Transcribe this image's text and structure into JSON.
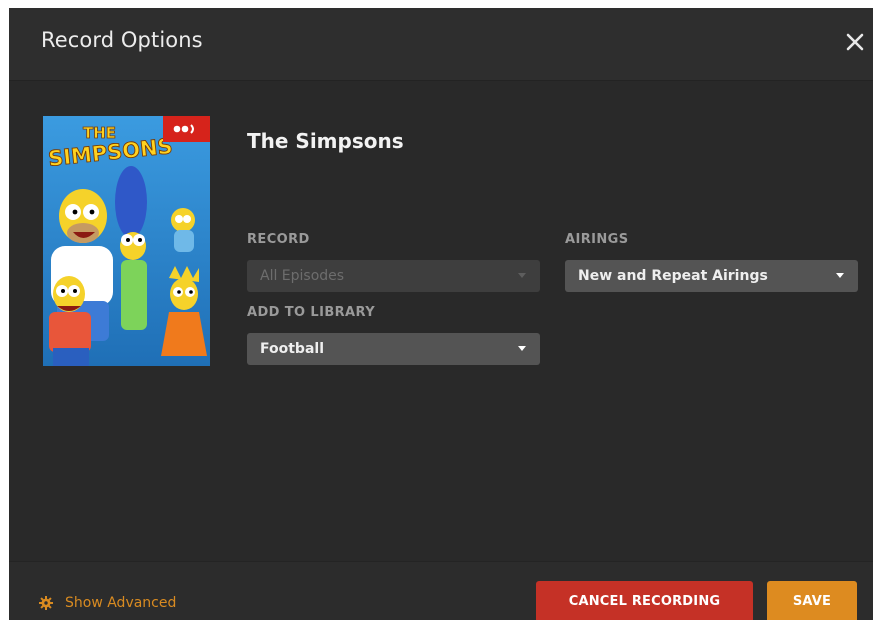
{
  "dialog": {
    "title": "Record Options"
  },
  "show": {
    "title": "The Simpsons",
    "poster": {
      "logo_text": "THE SIMPSONS",
      "background_color": "#2e8fd6",
      "badge_color": "#d6231b"
    }
  },
  "record": {
    "label": "RECORD",
    "value": "All Episodes",
    "disabled": true
  },
  "airings": {
    "label": "AIRINGS",
    "value": "New and Repeat Airings"
  },
  "library": {
    "label": "ADD TO LIBRARY",
    "value": "Football"
  },
  "footer": {
    "advanced_label": "Show Advanced",
    "cancel_label": "CANCEL RECORDING",
    "save_label": "SAVE"
  },
  "colors": {
    "dialog_bg": "#292929",
    "accent": "#dd8b20",
    "danger": "#c53126",
    "select_bg": "#545454"
  }
}
